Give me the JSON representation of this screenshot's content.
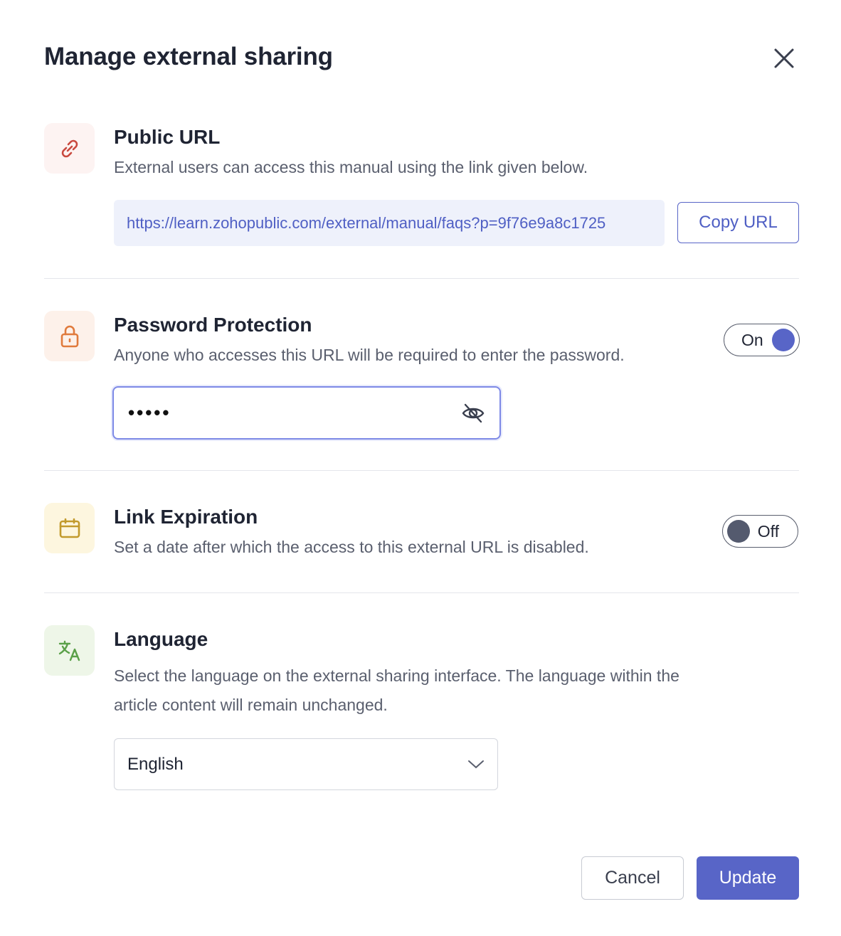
{
  "dialog": {
    "title": "Manage external sharing"
  },
  "public_url": {
    "title": "Public URL",
    "description": "External users can access this manual using the link given below.",
    "url": "https://learn.zohopublic.com/external/manual/faqs?p=9f76e9a8c1725",
    "copy_label": "Copy URL",
    "icon": "link-icon"
  },
  "password_protection": {
    "title": "Password Protection",
    "description": "Anyone who accesses this URL will be required to enter the password.",
    "toggle_label": "On",
    "password_masked": "•••••",
    "icon": "lock-icon",
    "visibility_icon": "eye-off-icon"
  },
  "link_expiration": {
    "title": "Link Expiration",
    "description": "Set a date after which the access to this external URL is disabled.",
    "toggle_label": "Off",
    "icon": "calendar-icon"
  },
  "language": {
    "title": "Language",
    "description_line1": "Select the language on the external sharing interface. The language within the",
    "description_line2": "article content will remain unchanged.",
    "selected": "English",
    "icon": "translate-icon"
  },
  "footer": {
    "cancel_label": "Cancel",
    "update_label": "Update"
  },
  "colors": {
    "accent": "#5865c7",
    "url_bg": "#eef1fb",
    "link_icon_bg": "#fdf3f2",
    "lock_icon_bg": "#fdf1ea",
    "calendar_icon_bg": "#fdf6df",
    "translate_icon_bg": "#eef6e8",
    "toggle_off_knob": "#545a6e"
  }
}
